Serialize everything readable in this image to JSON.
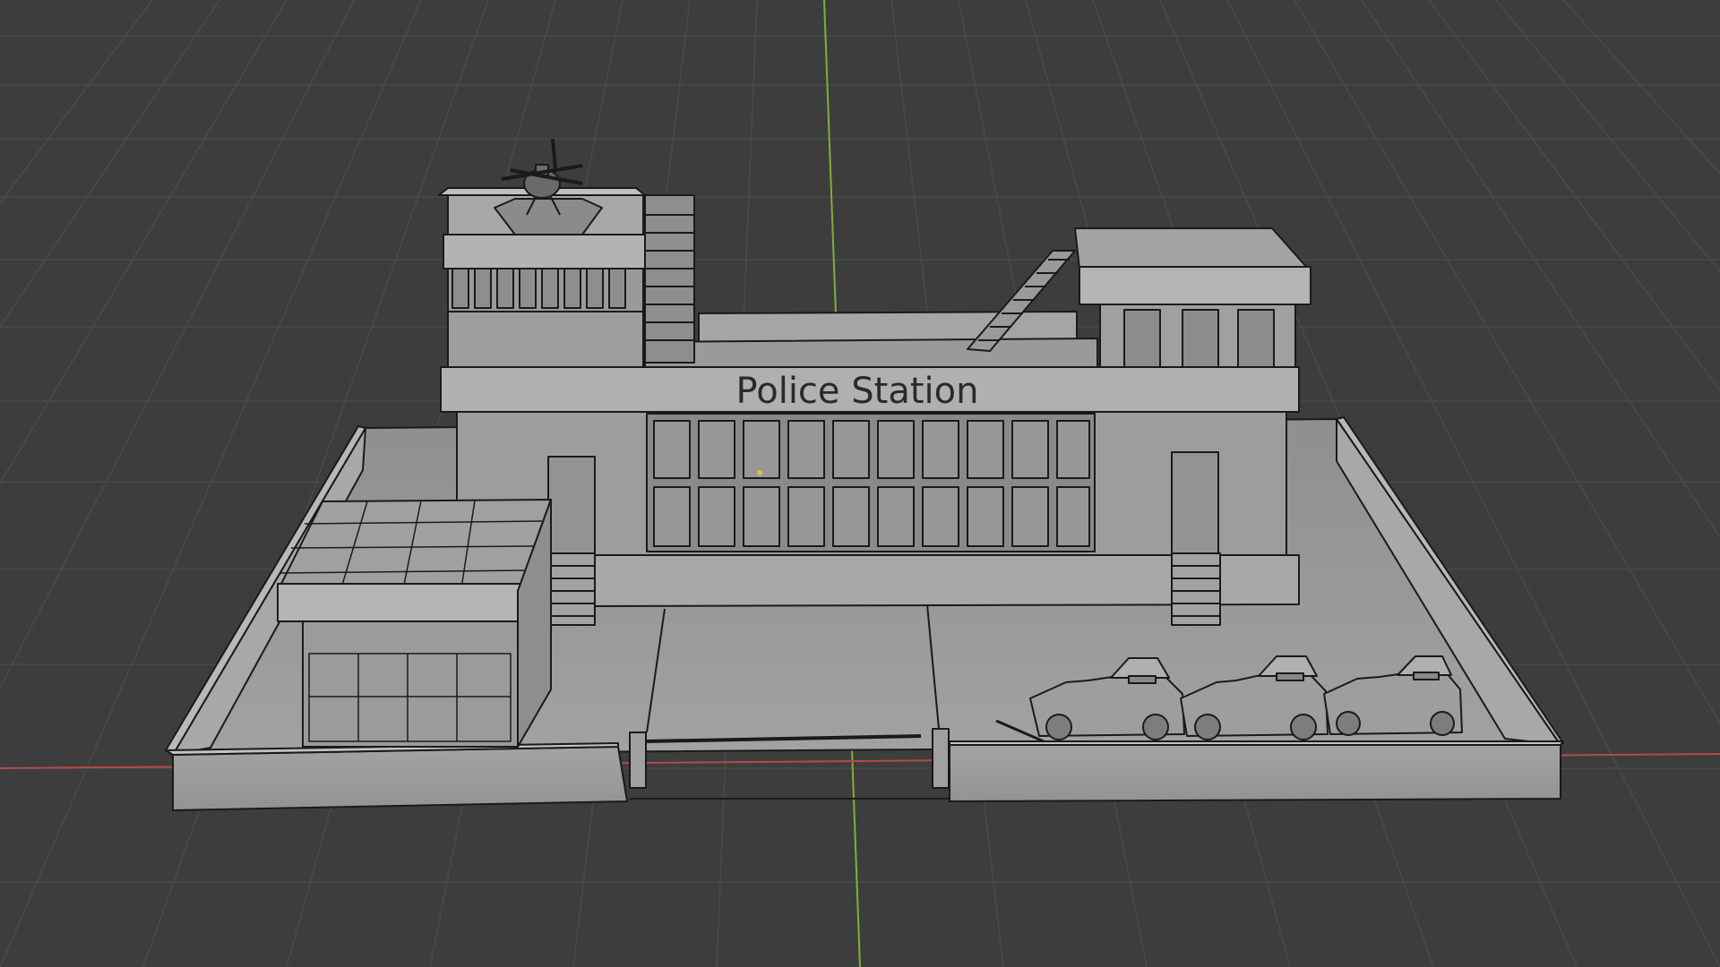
{
  "viewport": {
    "background_color": "#3d3d3d",
    "grid_color": "#4a4a4a",
    "x_axis_color": "#b54a4a",
    "y_axis_color": "#7fae3c"
  },
  "model": {
    "sign_text": "Police Station",
    "surface_color": "#9c9c9c",
    "edge_color": "#1a1a1a"
  }
}
